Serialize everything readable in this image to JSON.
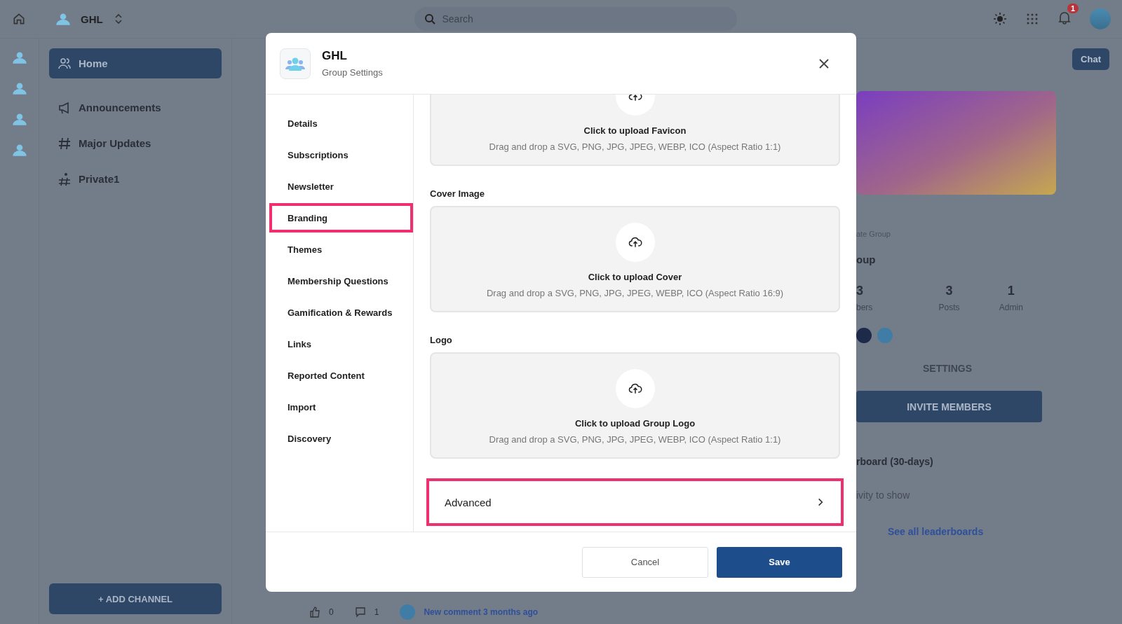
{
  "topbar": {
    "group_name": "GHL",
    "search": {
      "placeholder": "Search"
    },
    "notification_count": "1"
  },
  "channels": [
    {
      "label": "Home",
      "selected": true,
      "kind": "home"
    },
    {
      "label": "Announcements",
      "selected": false,
      "kind": "megaphone"
    },
    {
      "label": "Major Updates",
      "selected": false,
      "kind": "hash"
    },
    {
      "label": "Private1",
      "selected": false,
      "kind": "private"
    }
  ],
  "add_channel": "+ ADD CHANNEL",
  "main": {
    "chat": "Chat",
    "group_type": "ate Group",
    "group_name": "oup",
    "stats": [
      {
        "value": "3",
        "label": "bers"
      },
      {
        "value": "3",
        "label": "Posts"
      },
      {
        "value": "1",
        "label": "Admin"
      }
    ],
    "settings": "SETTINGS",
    "invite": "INVITE MEMBERS",
    "leaderboard_title": "rboard (30-days)",
    "leaderboard_empty": "ivity to show",
    "leaderboard_link": "See all leaderboards",
    "post": {
      "likes": "0",
      "comments": "1",
      "meta": "New comment 3 months ago"
    }
  },
  "modal": {
    "title": "GHL",
    "subtitle": "Group Settings",
    "nav": [
      {
        "label": "Details",
        "selected": false
      },
      {
        "label": "Subscriptions",
        "selected": false
      },
      {
        "label": "Newsletter",
        "selected": false
      },
      {
        "label": "Branding",
        "selected": true
      },
      {
        "label": "Themes",
        "selected": false
      },
      {
        "label": "Membership Questions",
        "selected": false
      },
      {
        "label": "Gamification & Rewards",
        "selected": false
      },
      {
        "label": "Links",
        "selected": false
      },
      {
        "label": "Reported Content",
        "selected": false
      },
      {
        "label": "Import",
        "selected": false
      },
      {
        "label": "Discovery",
        "selected": false
      }
    ],
    "uploads": [
      {
        "title": "Click to upload Favicon",
        "hint": "Drag and drop a SVG, PNG, JPG, JPEG, WEBP, ICO (Aspect Ratio 1:1)"
      },
      {
        "label": "Cover Image",
        "title": "Click to upload Cover",
        "hint": "Drag and drop a SVG, PNG, JPG, JPEG, WEBP, ICO (Aspect Ratio 16:9)"
      },
      {
        "label": "Logo",
        "title": "Click to upload Group Logo",
        "hint": "Drag and drop a SVG, PNG, JPG, JPEG, WEBP, ICO (Aspect Ratio 1:1)"
      }
    ],
    "advanced": {
      "label": "Advanced",
      "highlighted": true
    },
    "buttons": {
      "cancel": "Cancel",
      "save": "Save"
    }
  }
}
